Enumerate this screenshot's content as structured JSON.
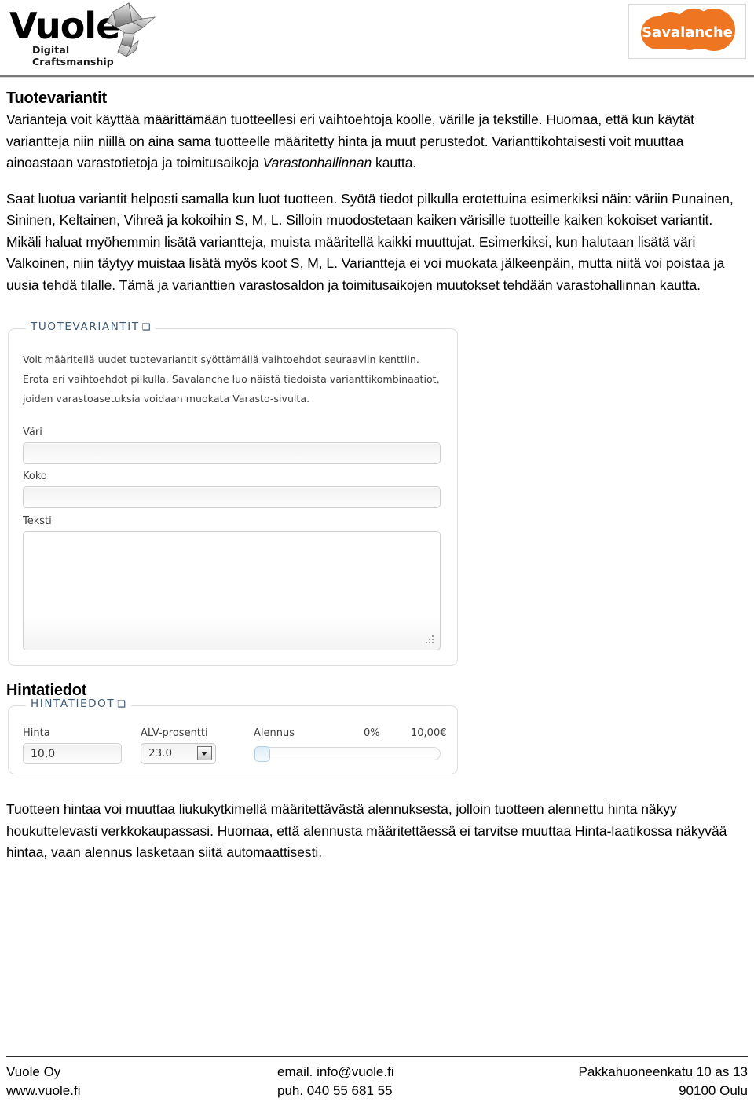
{
  "header": {
    "brand_name": "Vuole",
    "brand_tagline": "Digital Craftsmanship",
    "partner_logo_text": "Savalanche",
    "partner_logo_color": "#ee7623",
    "bird_icon": "origami-bird-icon"
  },
  "document": {
    "title": "Tuotevariantit",
    "paragraph_1_part1": "Varianteja voit käyttää määrittämään tuotteellesi eri vaihtoehtoja koolle, värille ja tekstille. Huomaa, että kun käytät variantteja niin niillä on aina sama tuotteelle määritetty hinta ja muut perustedot. Varianttikohtaisesti voit muuttaa ainoastaan varastotietoja ja toimitusaikoja ",
    "paragraph_1_italic": "Varastonhallinnan",
    "paragraph_1_part2": " kautta.",
    "paragraph_2": "Saat luotua variantit helposti samalla kun luot tuotteen. Syötä tiedot pilkulla erotettuina esimerkiksi näin: väriin Punainen, Sininen, Keltainen, Vihreä ja kokoihin S, M, L. Silloin muodostetaan kaiken värisille tuotteille kaiken kokoiset variantit. Mikäli haluat myöhemmin lisätä variantteja, muista määritellä kaikki muuttujat. Esimerkiksi, kun halutaan lisätä väri Valkoinen, niin täytyy muistaa lisätä myös koot S, M, L. Variantteja ei voi muokata jälkeenpäin, mutta niitä voi poistaa ja uusia tehdä tilalle. Tämä ja varianttien varastosaldon ja toimitusaikojen muutokset tehdään varastohallinnan kautta.",
    "subtitle_price": "Hintatiedot",
    "paragraph_3": "Tuotteen hintaa voi muuttaa liukukytkimellä määritettävästä alennuksesta, jolloin tuotteen alennettu hinta näkyy houkuttelevasti verkkokaupassasi. Huomaa, että alennusta määritettäessä ei tarvitse muuttaa Hinta-laatikossa näkyvää hintaa, vaan alennus lasketaan siitä automaattisesti."
  },
  "variants_panel": {
    "legend": "TUOTEVARIANTIT",
    "legend_chevron": "chevron-down-icon",
    "description": "Voit määritellä uudet tuotevariantit syöttämällä vaihtoehdot seuraaviin kenttiin. Erota eri vaihtoehdot pilkulla. Savalanche luo näistä tiedoista varianttikombinaatiot, joiden varastoasetuksia voidaan muokata Varasto-sivulta.",
    "fields": [
      {
        "label": "Väri",
        "value": "",
        "type": "text"
      },
      {
        "label": "Koko",
        "value": "",
        "type": "text"
      },
      {
        "label": "Teksti",
        "value": "",
        "type": "textarea"
      }
    ]
  },
  "price_panel": {
    "legend": "HINTATIEDOT",
    "legend_chevron": "chevron-down-icon",
    "price_label": "Hinta",
    "price_value": "10,0",
    "vat_label": "ALV-prosentti",
    "vat_value": "23.0",
    "discount_label": "Alennus",
    "discount_percent": "0%",
    "discount_amount": "10,00€",
    "slider_position_percent": 0
  },
  "footer": {
    "company": "Vuole Oy",
    "website": "www.vuole.fi",
    "email": "email. info@vuole.fi",
    "phone": "puh. 040 55 681 55",
    "address_line1": "Pakkahuoneenkatu 10 as 13",
    "address_line2": "90100 Oulu"
  }
}
